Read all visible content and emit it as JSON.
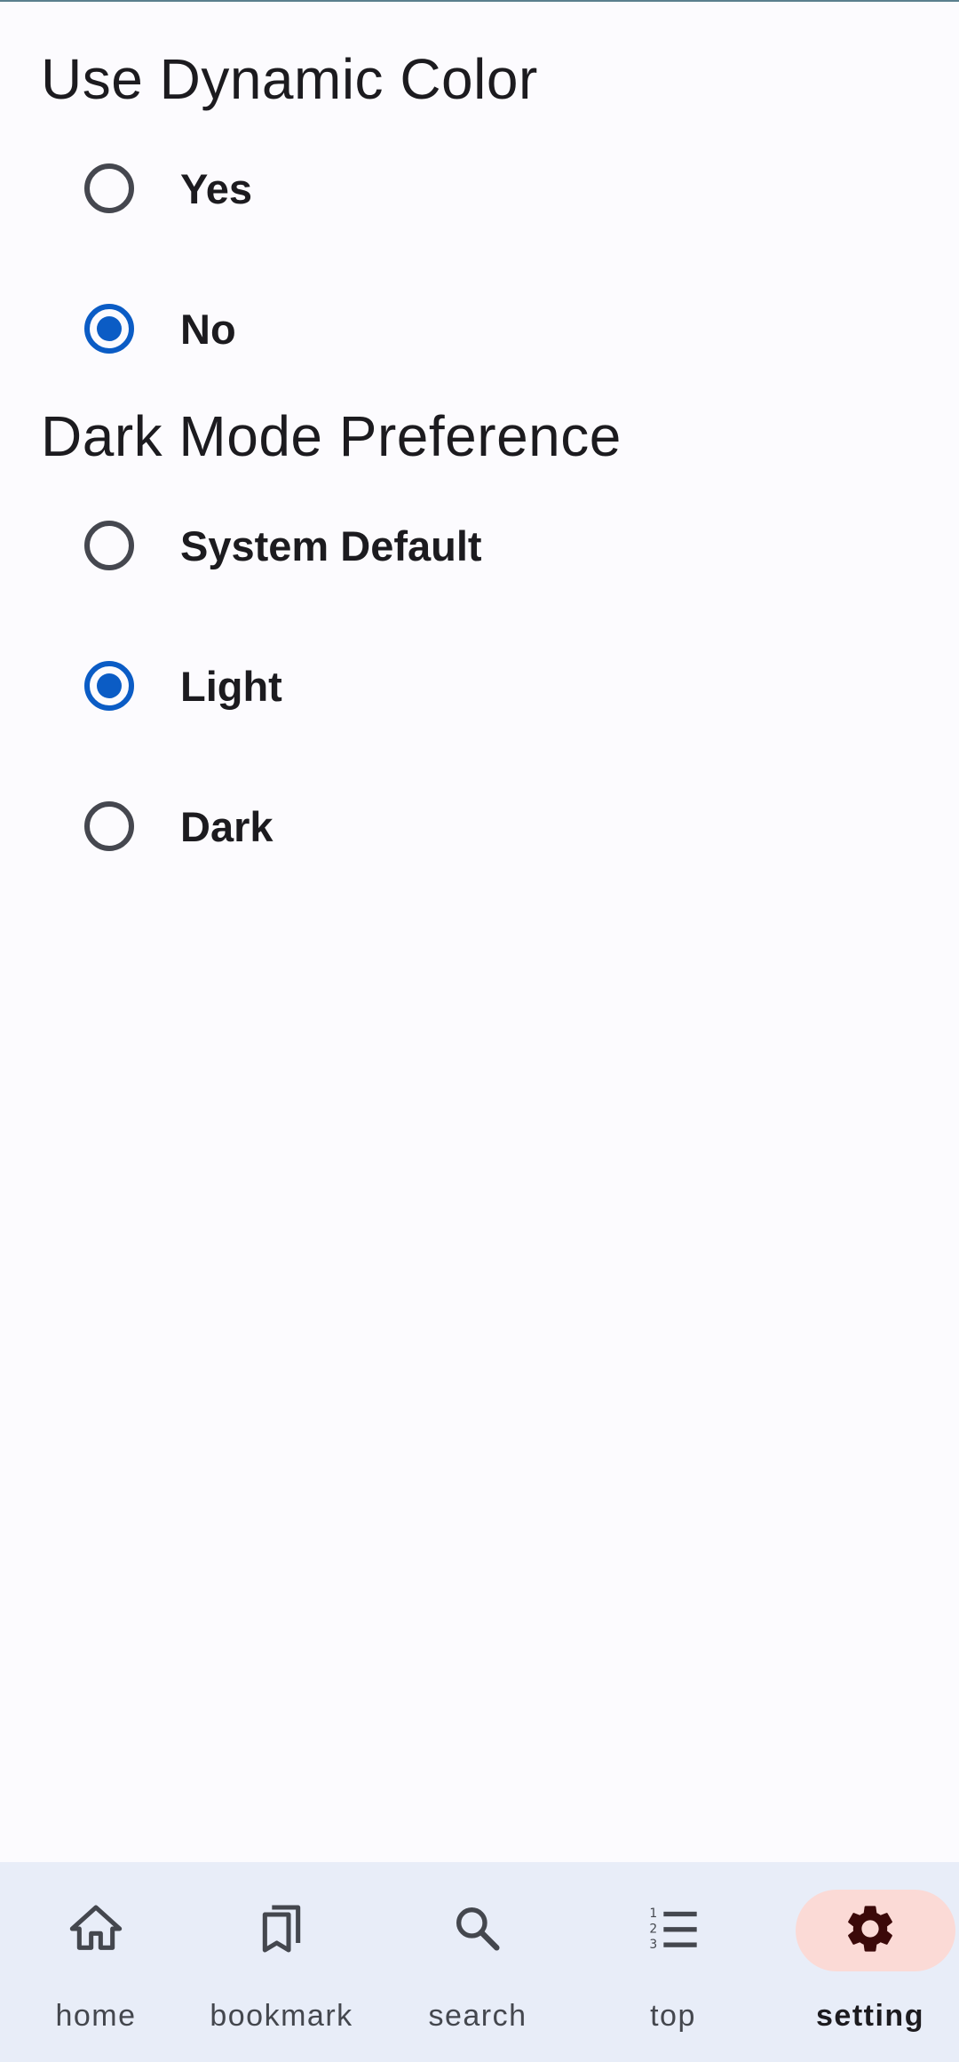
{
  "settings": {
    "dynamic_color": {
      "title": "Use Dynamic Color",
      "options": [
        {
          "label": "Yes",
          "selected": false
        },
        {
          "label": "No",
          "selected": true
        }
      ]
    },
    "dark_mode": {
      "title": "Dark Mode Preference",
      "options": [
        {
          "label": "System Default",
          "selected": false
        },
        {
          "label": "Light",
          "selected": true
        },
        {
          "label": "Dark",
          "selected": false
        }
      ]
    }
  },
  "bottom_nav": {
    "items": [
      {
        "label": "home",
        "icon": "home-icon",
        "active": false
      },
      {
        "label": "bookmark",
        "icon": "bookmarks-icon",
        "active": false
      },
      {
        "label": "search",
        "icon": "search-icon",
        "active": false
      },
      {
        "label": "top",
        "icon": "numbered-list-icon",
        "active": false
      },
      {
        "label": "setting",
        "icon": "gear-icon",
        "active": true
      }
    ]
  },
  "colors": {
    "background": "#fcfbfe",
    "radio_selected": "#0b5cc5",
    "radio_unselected": "#45474f",
    "nav_background": "#e8edf8",
    "nav_active_pill": "#fbdad6",
    "nav_active_icon": "#3b0909"
  }
}
